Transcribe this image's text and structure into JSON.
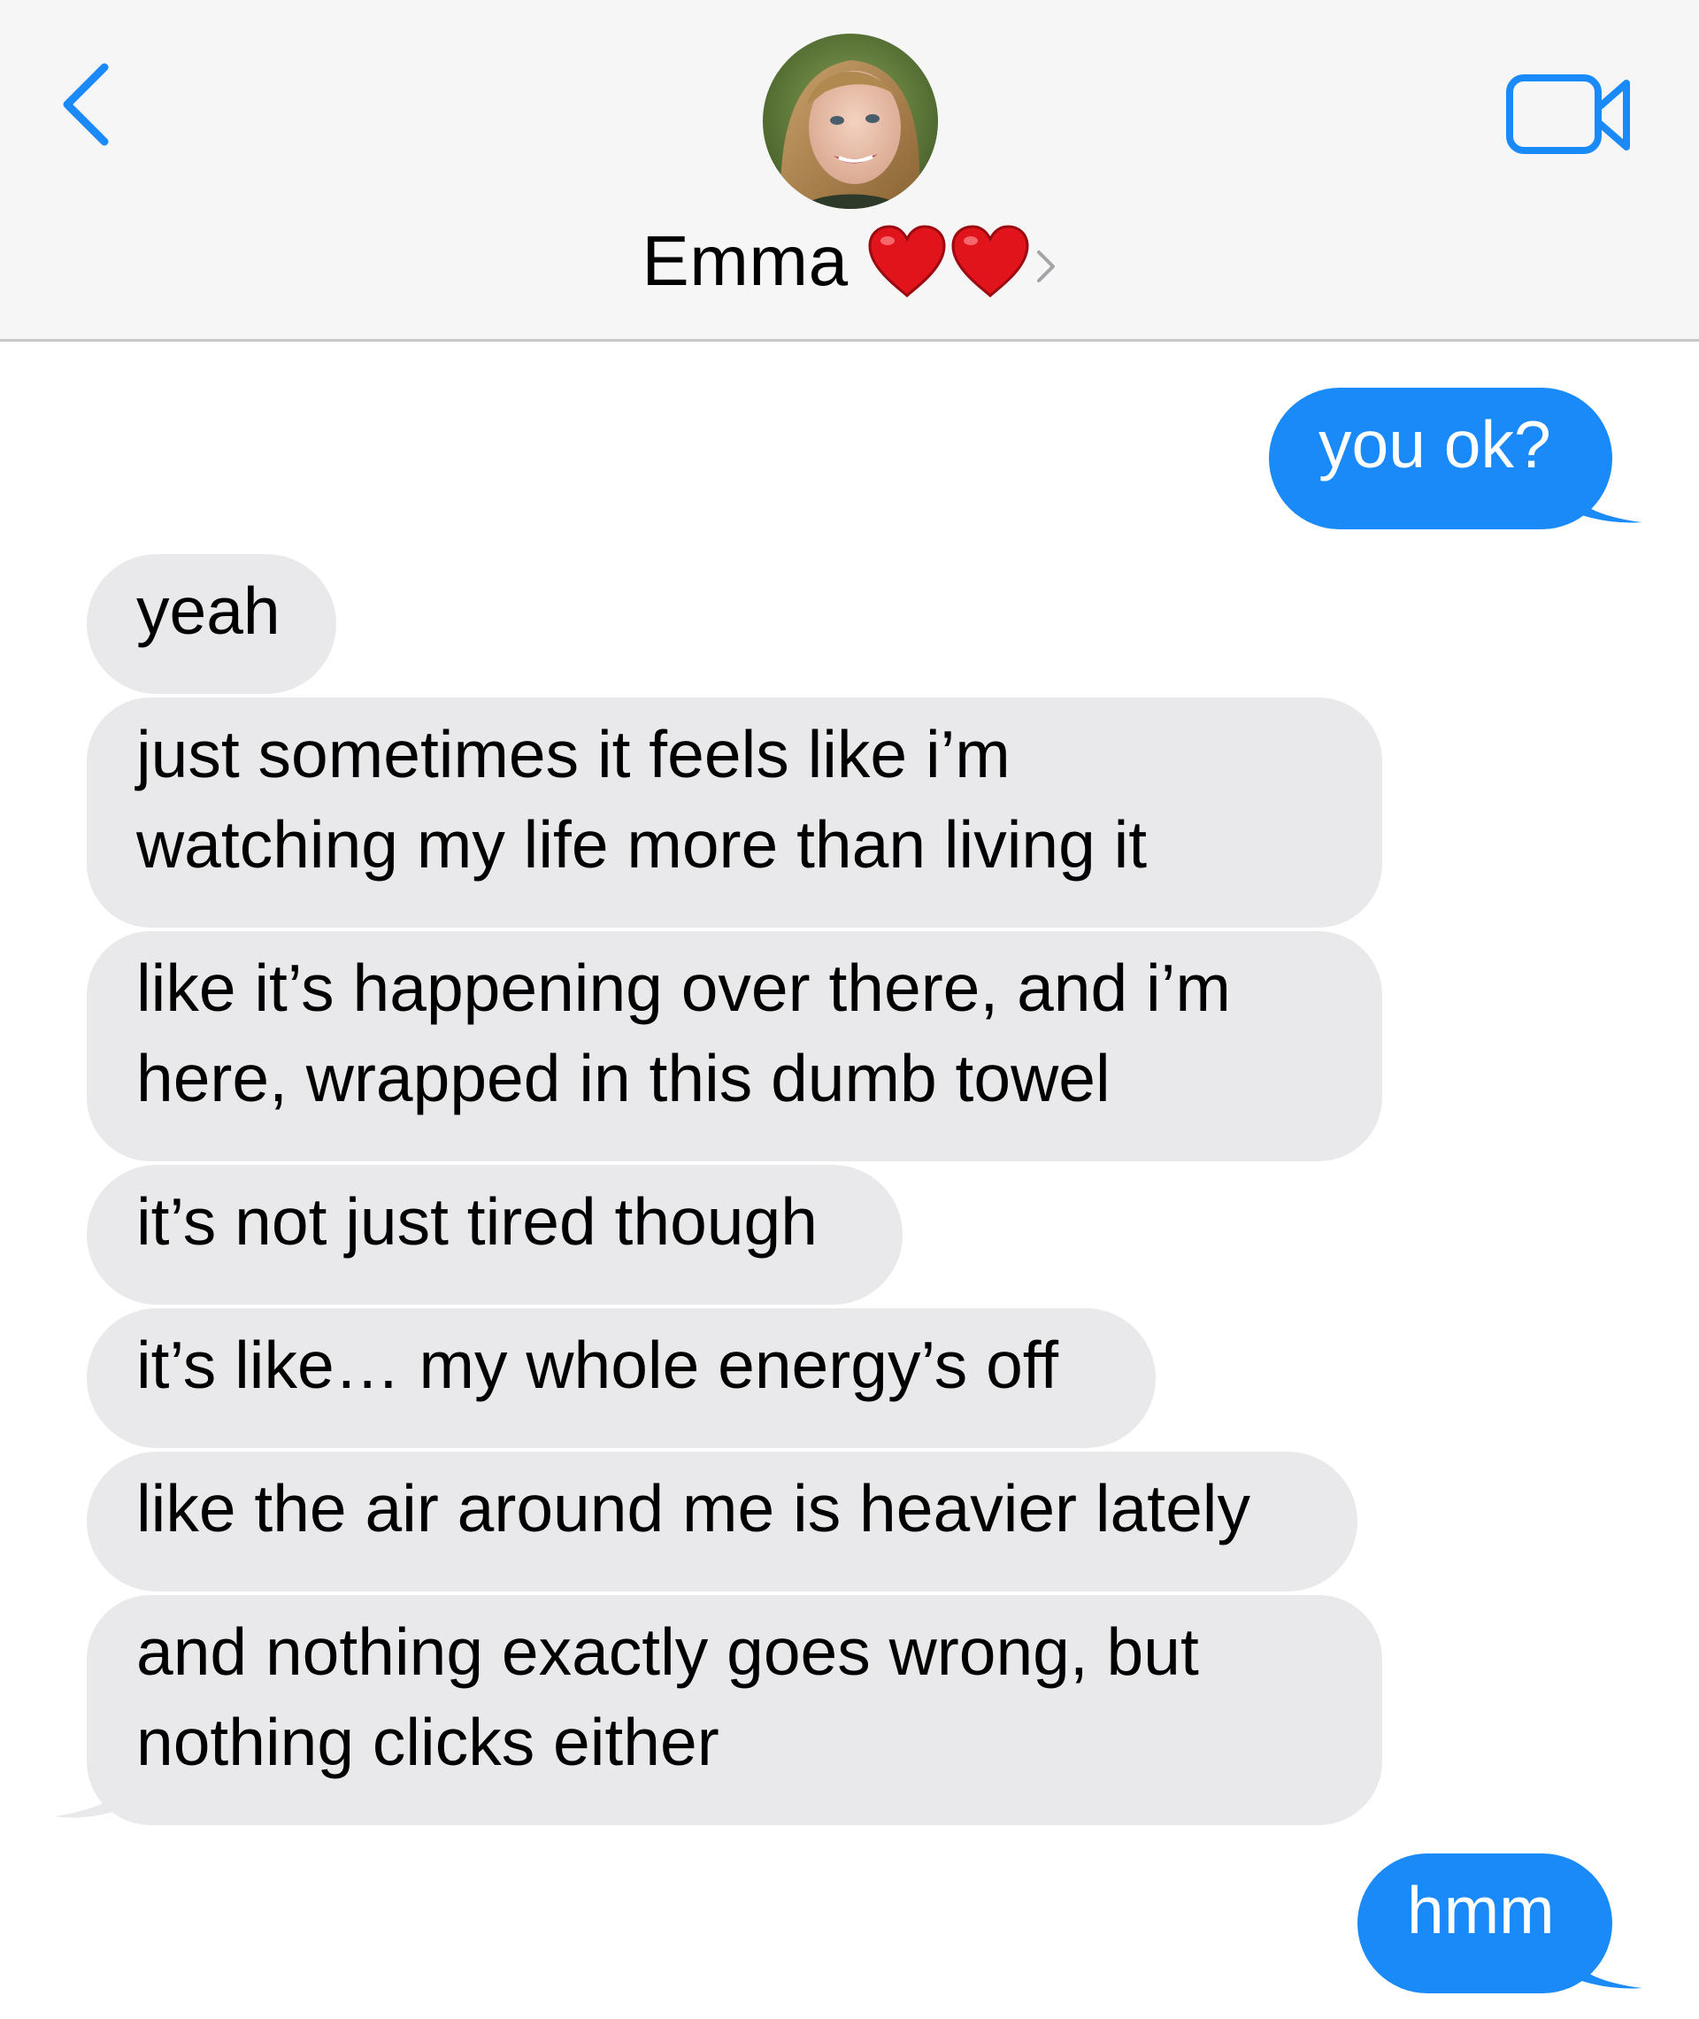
{
  "header": {
    "contact_name": "Emma",
    "contact_emoji": "❤️❤️",
    "back_icon": "chevron-left-icon",
    "video_icon": "video-camera-icon",
    "accent_color": "#1a8af9"
  },
  "messages": [
    {
      "direction": "outgoing",
      "text": "you ok?"
    },
    {
      "direction": "incoming",
      "text": "yeah"
    },
    {
      "direction": "incoming",
      "lines": [
        "just sometimes it feels like i’m",
        "watching my life more than living it"
      ]
    },
    {
      "direction": "incoming",
      "lines": [
        "like it’s happening over there, and i’m",
        "here, wrapped in this dumb towel"
      ]
    },
    {
      "direction": "incoming",
      "text": "it’s not just tired though"
    },
    {
      "direction": "incoming",
      "text": "it’s like… my whole energy’s off"
    },
    {
      "direction": "incoming",
      "text": "like the air around me is heavier lately"
    },
    {
      "direction": "incoming",
      "lines": [
        "and nothing exactly goes wrong, but",
        "nothing clicks either"
      ]
    },
    {
      "direction": "outgoing",
      "text": "hmm"
    }
  ],
  "colors": {
    "outgoing_bubble": "#1a8af9",
    "incoming_bubble": "#e9e9eb",
    "header_background": "#f6f6f6"
  }
}
